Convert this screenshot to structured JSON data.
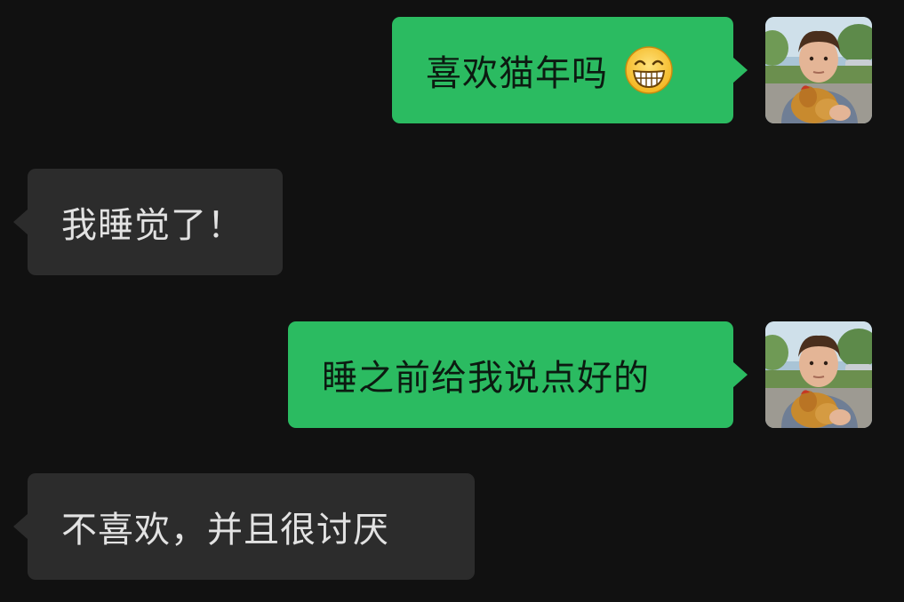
{
  "messages": [
    {
      "side": "out",
      "text": "喜欢猫年吗",
      "emoji": "grinning-face-emoji"
    },
    {
      "side": "in",
      "text": "我睡觉了！"
    },
    {
      "side": "out",
      "text": "睡之前给我说点好的"
    },
    {
      "side": "in",
      "text": "不喜欢，并且很讨厌"
    }
  ],
  "colors": {
    "background": "#111111",
    "outgoing_bubble": "#2bbb61",
    "incoming_bubble": "#2c2c2c"
  }
}
